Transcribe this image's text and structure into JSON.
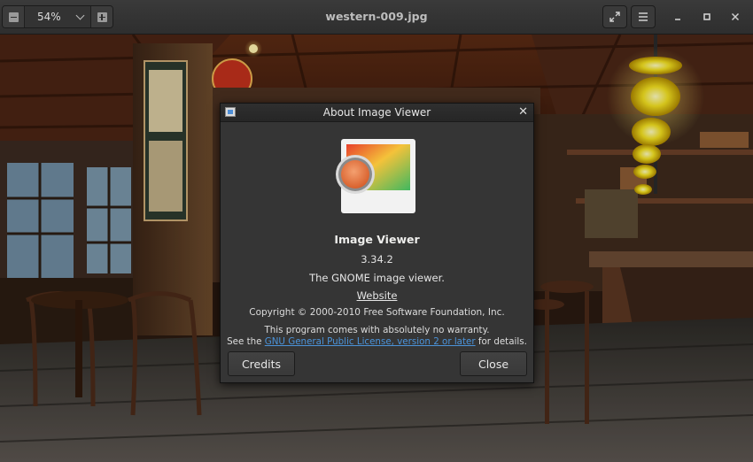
{
  "window": {
    "title": "western-009.jpg"
  },
  "zoom": {
    "value": "54%"
  },
  "dialog": {
    "title": "About Image Viewer",
    "close_glyph": "✕",
    "app_name": "Image Viewer",
    "version": "3.34.2",
    "comments": "The GNOME image viewer.",
    "website_label": "Website",
    "copyright": "Copyright © 2000-2010 Free Software Foundation, Inc.",
    "warranty": "This program comes with absolutely no warranty.",
    "license_prefix": "See the ",
    "license_link": "GNU General Public License, version 2 or later",
    "license_suffix": " for details.",
    "credits_label": "Credits",
    "close_label": "Close"
  },
  "colors": {
    "link": "#4b93d9",
    "dialog_bg": "#353535",
    "headerbar_bg": "#2e2e2e"
  }
}
